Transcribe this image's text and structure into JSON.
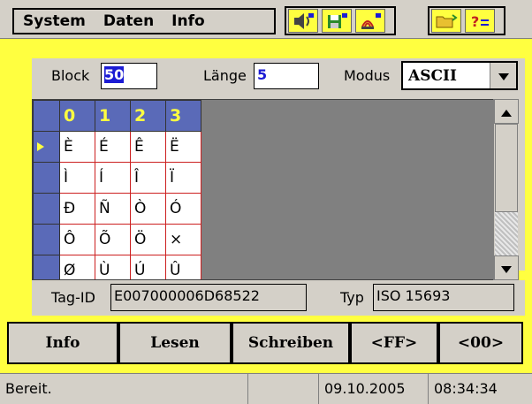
{
  "menu": {
    "items": [
      "System",
      "Daten",
      "Info"
    ]
  },
  "block": {
    "label": "Block",
    "value": "50"
  },
  "laenge": {
    "label": "Länge",
    "value": "5"
  },
  "modus": {
    "label": "Modus",
    "value": "ASCII"
  },
  "grid": {
    "columns": [
      "0",
      "1",
      "2",
      "3"
    ],
    "rows": [
      [
        "È",
        "É",
        "Ê",
        "Ë"
      ],
      [
        "Ì",
        "Í",
        "Î",
        "Ï"
      ],
      [
        "Ð",
        "Ñ",
        "Ò",
        "Ó"
      ],
      [
        "Ô",
        "Õ",
        "Ö",
        "×"
      ],
      [
        "Ø",
        "Ù",
        "Ú",
        "Û"
      ]
    ]
  },
  "tagid": {
    "label": "Tag-ID",
    "value": "E007000006D68522"
  },
  "typ": {
    "label": "Typ",
    "value": "ISO 15693"
  },
  "buttons": {
    "info": "Info",
    "lesen": "Lesen",
    "schreiben": "Schreiben",
    "ff": "<FF>",
    "zero": "<00>"
  },
  "status": {
    "text": "Bereit.",
    "date": "09.10.2005",
    "time": "08:34:34"
  },
  "colors": {
    "accent": "#ffff40",
    "header": "#5a6ab8",
    "selection": "#1c1cd4"
  }
}
